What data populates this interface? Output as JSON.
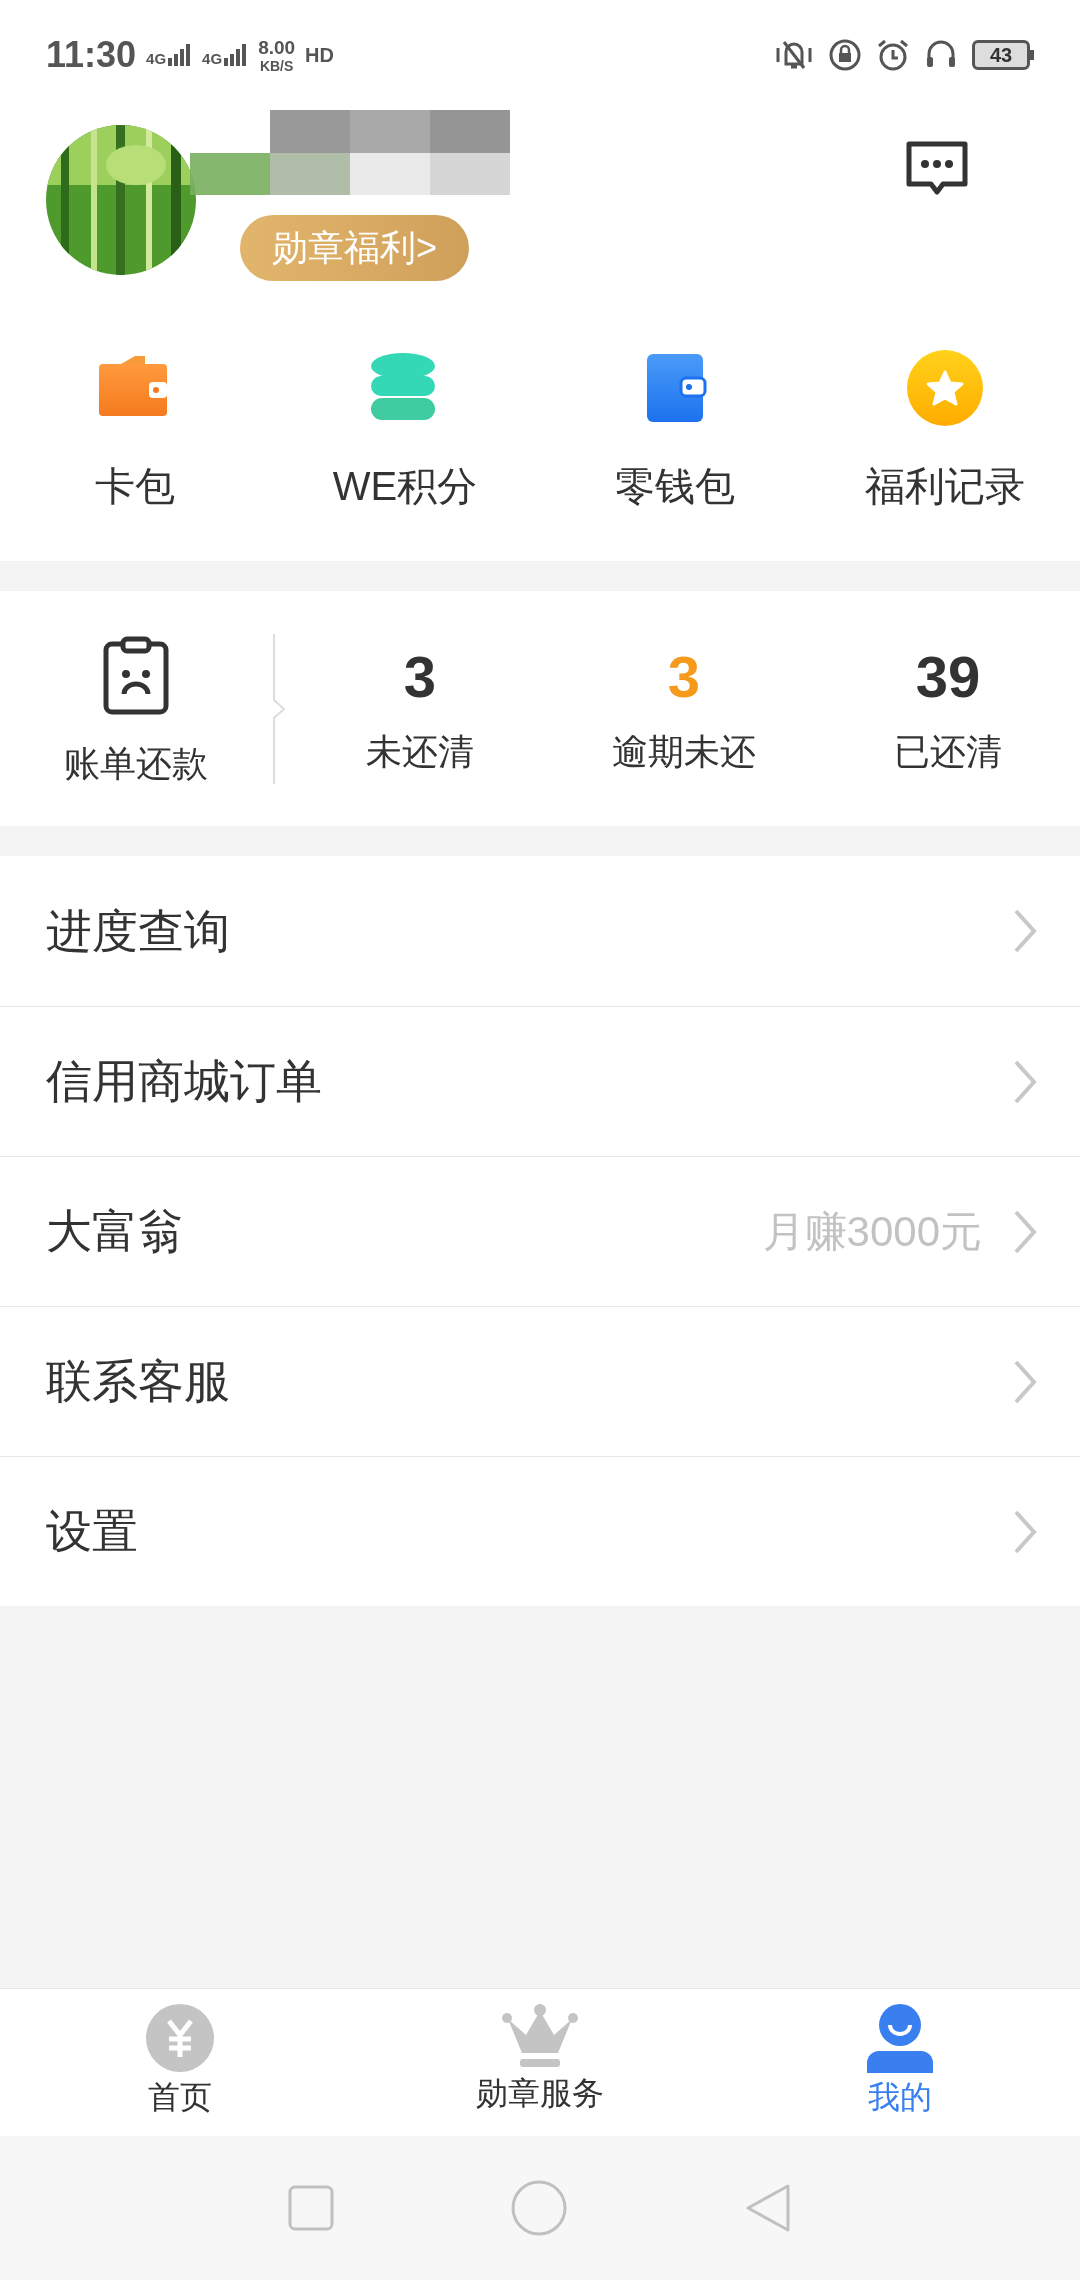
{
  "status_bar": {
    "time": "11:30",
    "network_1": "4G",
    "network_2": "4G",
    "speed": "8.00",
    "speed_unit": "KB/S",
    "hd": "HD",
    "battery": "43"
  },
  "profile": {
    "badge": "勋章福利>"
  },
  "shortcuts": [
    {
      "label": "卡包"
    },
    {
      "label": "WE积分"
    },
    {
      "label": "零钱包"
    },
    {
      "label": "福利记录"
    }
  ],
  "bills": {
    "title": "账单还款",
    "stats": [
      {
        "value": "3",
        "label": "未还清",
        "color": "#333333"
      },
      {
        "value": "3",
        "label": "逾期未还",
        "color": "#f59a1b"
      },
      {
        "value": "39",
        "label": "已还清",
        "color": "#333333"
      }
    ]
  },
  "menu": [
    {
      "label": "进度查询"
    },
    {
      "label": "信用商城订单"
    },
    {
      "label": "大富翁",
      "hint": "月赚3000元"
    },
    {
      "label": "联系客服"
    },
    {
      "label": "设置"
    }
  ],
  "tabs": [
    {
      "label": "首页",
      "selected": false
    },
    {
      "label": "勋章服务",
      "selected": false
    },
    {
      "label": "我的",
      "selected": true
    }
  ]
}
